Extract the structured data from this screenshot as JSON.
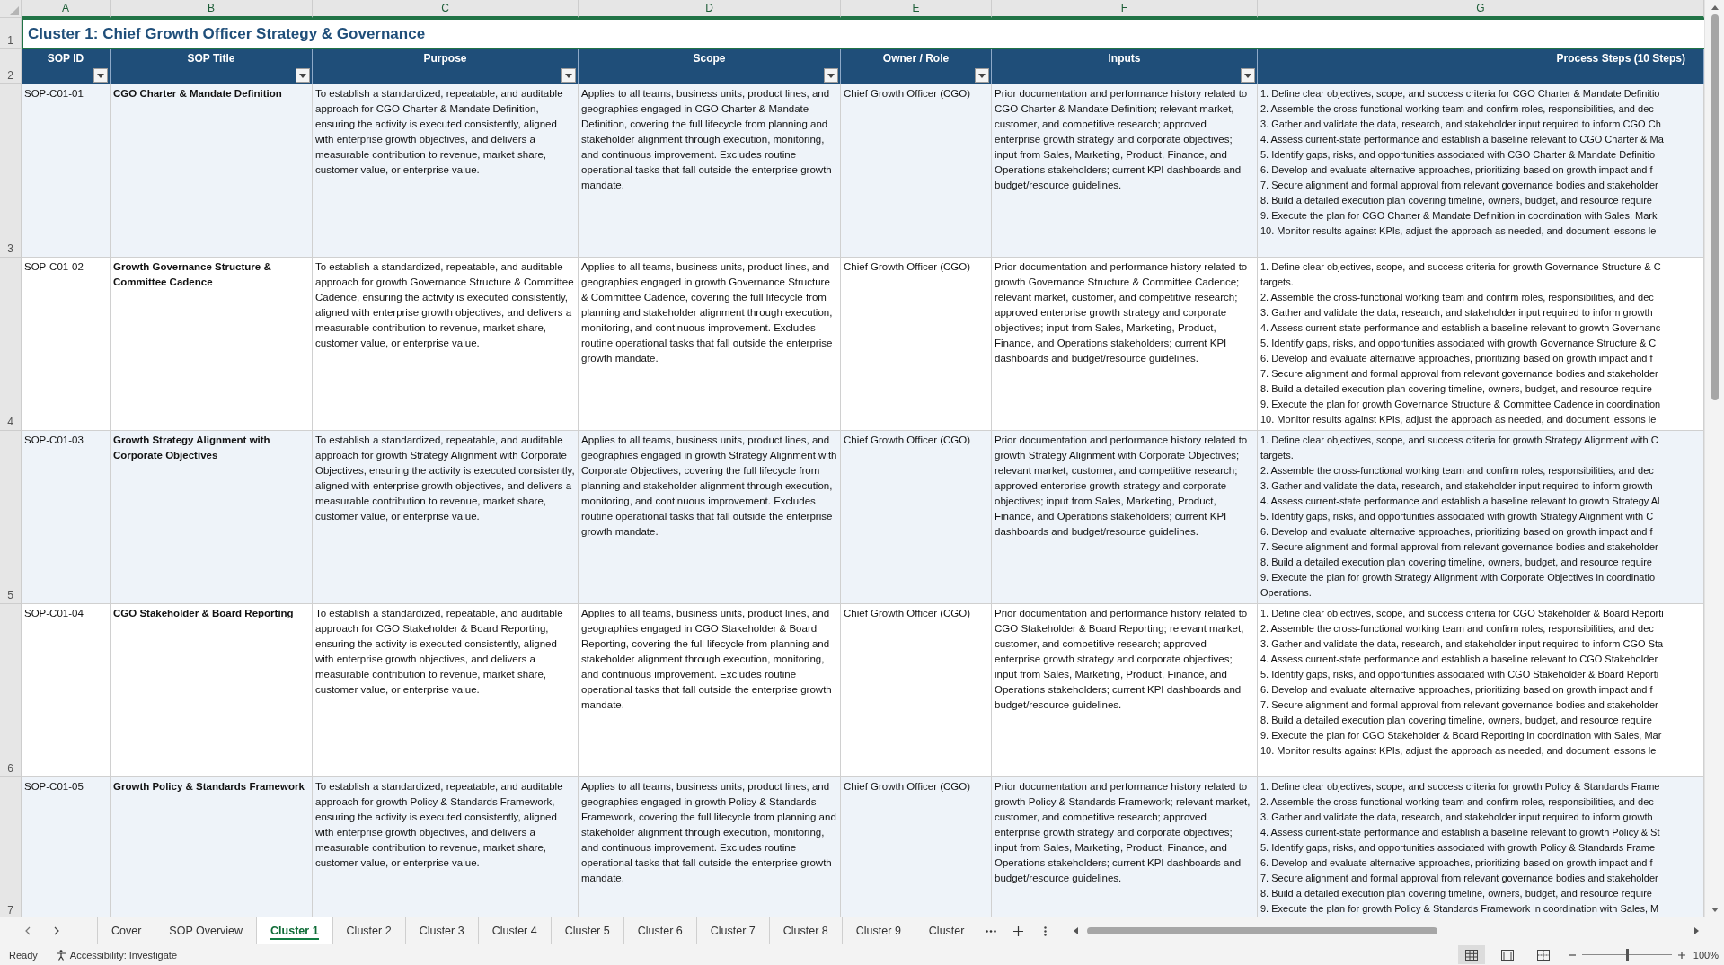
{
  "column_letters": [
    {
      "letter": "A",
      "selected": true
    },
    {
      "letter": "B",
      "selected": true
    },
    {
      "letter": "C",
      "selected": true
    },
    {
      "letter": "D",
      "selected": true
    },
    {
      "letter": "E",
      "selected": true
    },
    {
      "letter": "F",
      "selected": true
    },
    {
      "letter": "G",
      "selected": true
    }
  ],
  "title": {
    "row_number": "1",
    "text": "Cluster 1: Chief Growth Officer Strategy & Governance",
    "selected": true
  },
  "header": {
    "row_number": "2",
    "columns": [
      {
        "label": "SOP ID",
        "filter": true
      },
      {
        "label": "SOP Title",
        "filter": true
      },
      {
        "label": "Purpose",
        "filter": true
      },
      {
        "label": "Scope",
        "filter": true
      },
      {
        "label": "Owner / Role",
        "filter": true
      },
      {
        "label": "Inputs",
        "filter": true
      },
      {
        "label": "Process Steps (10 Steps)",
        "filter": false
      }
    ]
  },
  "rows": [
    {
      "row_number": "3",
      "sop_id": "SOP-C01-01",
      "sop_title": "CGO Charter & Mandate Definition",
      "purpose": "To establish a standardized, repeatable, and auditable approach for CGO Charter & Mandate Definition, ensuring the activity is executed consistently, aligned with enterprise growth objectives, and delivers a measurable contribution to revenue, market share, customer value, or enterprise value.",
      "scope": "Applies to all teams, business units, product lines, and geographies engaged in CGO Charter & Mandate Definition, covering the full lifecycle from planning and stakeholder alignment through execution, monitoring, and continuous improvement. Excludes routine operational tasks that fall outside the enterprise growth mandate.",
      "owner_role": "Chief Growth Officer (CGO)",
      "inputs": "Prior documentation and performance history related to CGO Charter & Mandate Definition; relevant market, customer, and competitive research; approved enterprise growth strategy and corporate objectives; input from Sales, Marketing, Product, Finance, and Operations stakeholders; current KPI dashboards and budget/resource guidelines.",
      "process_steps": [
        "1. Define clear objectives, scope, and success criteria for CGO Charter & Mandate Definitio",
        "2. Assemble the cross-functional working team and confirm roles, responsibilities, and dec",
        "3. Gather and validate the data, research, and stakeholder input required to inform CGO Ch",
        "4. Assess current-state performance and establish a baseline relevant to CGO Charter & Ma",
        "5. Identify gaps, risks, and opportunities associated with CGO Charter & Mandate Definitio",
        "6. Develop and evaluate alternative approaches, prioritizing based on growth impact and f",
        "7. Secure alignment and formal approval from relevant governance bodies and stakeholder",
        "8. Build a detailed execution plan covering timeline, owners, budget, and resource require",
        "9. Execute the plan for CGO Charter & Mandate Definition in coordination with Sales, Mark",
        "10. Monitor results against KPIs, adjust the approach as needed, and document lessons le"
      ]
    },
    {
      "row_number": "4",
      "sop_id": "SOP-C01-02",
      "sop_title": "Growth Governance Structure & Committee Cadence",
      "purpose": "To establish a standardized, repeatable, and auditable approach for growth Governance Structure & Committee Cadence, ensuring the activity is executed consistently, aligned with enterprise growth objectives, and delivers a measurable contribution to revenue, market share, customer value, or enterprise value.",
      "scope": "Applies to all teams, business units, product lines, and geographies engaged in growth Governance Structure & Committee Cadence, covering the full lifecycle from planning and stakeholder alignment through execution, monitoring, and continuous improvement. Excludes routine operational tasks that fall outside the enterprise growth mandate.",
      "owner_role": "Chief Growth Officer (CGO)",
      "inputs": "Prior documentation and performance history related to growth Governance Structure & Committee Cadence; relevant market, customer, and competitive research; approved enterprise growth strategy and corporate objectives; input from Sales, Marketing, Product, Finance, and Operations stakeholders; current KPI dashboards and budget/resource guidelines.",
      "process_steps": [
        "1. Define clear objectives, scope, and success criteria for growth Governance Structure & C",
        "targets.",
        "2. Assemble the cross-functional working team and confirm roles, responsibilities, and dec",
        "3. Gather and validate the data, research, and stakeholder input required to inform growth",
        "4. Assess current-state performance and establish a baseline relevant to growth Governanc",
        "5. Identify gaps, risks, and opportunities associated with growth Governance Structure & C",
        "6. Develop and evaluate alternative approaches, prioritizing based on growth impact and f",
        "7. Secure alignment and formal approval from relevant governance bodies and stakeholder",
        "8. Build a detailed execution plan covering timeline, owners, budget, and resource require",
        "9. Execute the plan for growth Governance Structure & Committee Cadence in coordination",
        "10. Monitor results against KPIs, adjust the approach as needed, and document lessons le"
      ]
    },
    {
      "row_number": "5",
      "sop_id": "SOP-C01-03",
      "sop_title": "Growth Strategy Alignment with Corporate Objectives",
      "purpose": "To establish a standardized, repeatable, and auditable approach for growth Strategy Alignment with Corporate Objectives, ensuring the activity is executed consistently, aligned with enterprise growth objectives, and delivers a measurable contribution to revenue, market share, customer value, or enterprise value.",
      "scope": "Applies to all teams, business units, product lines, and geographies engaged in growth Strategy Alignment with Corporate Objectives, covering the full lifecycle from planning and stakeholder alignment through execution, monitoring, and continuous improvement. Excludes routine operational tasks that fall outside the enterprise growth mandate.",
      "owner_role": "Chief Growth Officer (CGO)",
      "inputs": "Prior documentation and performance history related to growth Strategy Alignment with Corporate Objectives; relevant market, customer, and competitive research; approved enterprise growth strategy and corporate objectives; input from Sales, Marketing, Product, Finance, and Operations stakeholders; current KPI dashboards and budget/resource guidelines.",
      "process_steps": [
        "1. Define clear objectives, scope, and success criteria for growth Strategy Alignment with C",
        "targets.",
        "2. Assemble the cross-functional working team and confirm roles, responsibilities, and dec",
        "3. Gather and validate the data, research, and stakeholder input required to inform growth",
        "4. Assess current-state performance and establish a baseline relevant to growth Strategy Al",
        "5. Identify gaps, risks, and opportunities associated with growth Strategy Alignment with C",
        "6. Develop and evaluate alternative approaches, prioritizing based on growth impact and f",
        "7. Secure alignment and formal approval from relevant governance bodies and stakeholder",
        "8. Build a detailed execution plan covering timeline, owners, budget, and resource require",
        "9. Execute the plan for growth Strategy Alignment with Corporate Objectives in coordinatio",
        "Operations."
      ]
    },
    {
      "row_number": "6",
      "sop_id": "SOP-C01-04",
      "sop_title": "CGO Stakeholder & Board Reporting",
      "purpose": "To establish a standardized, repeatable, and auditable approach for CGO Stakeholder & Board Reporting, ensuring the activity is executed consistently, aligned with enterprise growth objectives, and delivers a measurable contribution to revenue, market share, customer value, or enterprise value.",
      "scope": "Applies to all teams, business units, product lines, and geographies engaged in CGO Stakeholder & Board Reporting, covering the full lifecycle from planning and stakeholder alignment through execution, monitoring, and continuous improvement. Excludes routine operational tasks that fall outside the enterprise growth mandate.",
      "owner_role": "Chief Growth Officer (CGO)",
      "inputs": "Prior documentation and performance history related to CGO Stakeholder & Board Reporting; relevant market, customer, and competitive research; approved enterprise growth strategy and corporate objectives; input from Sales, Marketing, Product, Finance, and Operations stakeholders; current KPI dashboards and budget/resource guidelines.",
      "process_steps": [
        "1. Define clear objectives, scope, and success criteria for CGO Stakeholder & Board Reporti",
        "2. Assemble the cross-functional working team and confirm roles, responsibilities, and dec",
        "3. Gather and validate the data, research, and stakeholder input required to inform CGO Sta",
        "4. Assess current-state performance and establish a baseline relevant to CGO Stakeholder",
        "5. Identify gaps, risks, and opportunities associated with CGO Stakeholder & Board Reporti",
        "6. Develop and evaluate alternative approaches, prioritizing based on growth impact and f",
        "7. Secure alignment and formal approval from relevant governance bodies and stakeholder",
        "8. Build a detailed execution plan covering timeline, owners, budget, and resource require",
        "9. Execute the plan for CGO Stakeholder & Board Reporting in coordination with Sales, Mar",
        "10. Monitor results against KPIs, adjust the approach as needed, and document lessons le"
      ]
    },
    {
      "row_number": "7",
      "sop_id": "SOP-C01-05",
      "sop_title": "Growth Policy & Standards Framework",
      "purpose": "To establish a standardized, repeatable, and auditable approach for growth Policy & Standards Framework, ensuring the activity is executed consistently, aligned with enterprise growth objectives, and delivers a measurable contribution to revenue, market share, customer value, or enterprise value.",
      "scope": "Applies to all teams, business units, product lines, and geographies engaged in growth Policy & Standards Framework, covering the full lifecycle from planning and stakeholder alignment through execution, monitoring, and continuous improvement. Excludes routine operational tasks that fall outside the enterprise growth mandate.",
      "owner_role": "Chief Growth Officer (CGO)",
      "inputs": "Prior documentation and performance history related to growth Policy & Standards Framework; relevant market, customer, and competitive research; approved enterprise growth strategy and corporate objectives; input from Sales, Marketing, Product, Finance, and Operations stakeholders; current KPI dashboards and budget/resource guidelines.",
      "process_steps": [
        "1. Define clear objectives, scope, and success criteria for growth Policy & Standards Frame",
        "2. Assemble the cross-functional working team and confirm roles, responsibilities, and dec",
        "3. Gather and validate the data, research, and stakeholder input required to inform growth",
        "4. Assess current-state performance and establish a baseline relevant to growth Policy & St",
        "5. Identify gaps, risks, and opportunities associated with growth Policy & Standards Frame",
        "6. Develop and evaluate alternative approaches, prioritizing based on growth impact and f",
        "7. Secure alignment and formal approval from relevant governance bodies and stakeholder",
        "8. Build a detailed execution plan covering timeline, owners, budget, and resource require",
        "9. Execute the plan for growth Policy & Standards Framework in coordination with Sales, M"
      ]
    }
  ],
  "sheet_tabs": [
    {
      "label": "Cover",
      "selected": false
    },
    {
      "label": "SOP Overview",
      "selected": false
    },
    {
      "label": "Cluster 1",
      "selected": true
    },
    {
      "label": "Cluster 2",
      "selected": false
    },
    {
      "label": "Cluster 3",
      "selected": false
    },
    {
      "label": "Cluster 4",
      "selected": false
    },
    {
      "label": "Cluster 5",
      "selected": false
    },
    {
      "label": "Cluster 6",
      "selected": false
    },
    {
      "label": "Cluster 7",
      "selected": false
    },
    {
      "label": "Cluster 8",
      "selected": false
    },
    {
      "label": "Cluster 9",
      "selected": false
    },
    {
      "label": "Cluster",
      "selected": false
    }
  ],
  "status_bar": {
    "status": "Ready",
    "accessibility": "Accessibility: Investigate",
    "views": [
      {
        "kind": "normal",
        "selected": true
      },
      {
        "kind": "page_layout",
        "selected": false
      },
      {
        "kind": "page_break",
        "selected": false
      }
    ],
    "zoom": {
      "level": 0.5,
      "reading": "100%"
    }
  }
}
